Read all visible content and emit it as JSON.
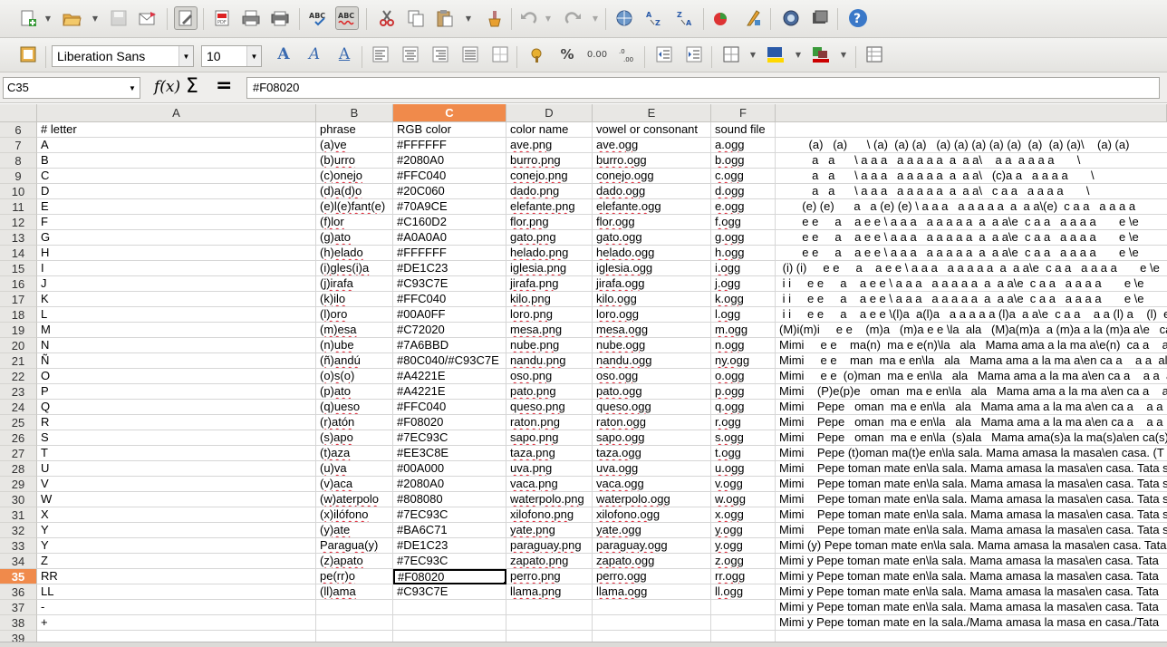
{
  "toolbar1": {
    "icons": [
      "new-icon",
      "open-icon",
      "save-icon",
      "email-icon",
      "edit-mode-icon",
      "export-pdf-icon",
      "print-icon",
      "print-preview-icon",
      "spellcheck-icon",
      "autospell-icon",
      "cut-icon",
      "copy-icon",
      "paste-icon",
      "clone-formatting-icon",
      "undo-icon",
      "redo-icon",
      "hyperlink-icon",
      "sort-ascending-icon",
      "sort-descending-icon",
      "chart-icon",
      "draw-functions-icon",
      "navigator-icon",
      "gallery-icon",
      "help-icon"
    ],
    "help_label": "?",
    "spell_label": "ABC"
  },
  "toolbar2": {
    "font_name": "Liberation Sans",
    "font_size": "10",
    "percent_label": "%",
    "decimal_label": "0.00"
  },
  "formula_bar": {
    "cell_ref": "C35",
    "fx_label": "f(x)",
    "sum_label": "Σ",
    "equal_label": "=",
    "content": "#F08020"
  },
  "columns": [
    "A",
    "B",
    "C",
    "D",
    "E",
    "F"
  ],
  "selected_column": "C",
  "selected_row": "35",
  "rows": [
    {
      "n": "6",
      "a": "# letter",
      "b": "phrase",
      "c": "RGB color",
      "d": "color name",
      "e": "vowel or consonant",
      "f": "sound file",
      "g": ""
    },
    {
      "n": "7",
      "a": "A",
      "b": "(a)ve",
      "c": "#FFFFFF",
      "d": "ave.png",
      "e": "ave.ogg",
      "f": "a.ogg",
      "g": "         (a)   (a)      \\ (a)  (a) (a)   (a) (a) (a) (a) (a)  (a)  (a) (a)\\    (a) (a)"
    },
    {
      "n": "8",
      "a": "B",
      "b": "(b)urro",
      "c": "#2080A0",
      "d": "burro.png",
      "e": "burro.ogg",
      "f": "b.ogg",
      "g": "          a   a      \\ a a a   a a a a a  a  a a\\    a a  a a a a       \\"
    },
    {
      "n": "9",
      "a": "C",
      "b": "(c)onejo",
      "c": "#FFC040",
      "d": "conejo.png",
      "e": "conejo.ogg",
      "f": "c.ogg",
      "g": "          a   a      \\ a a a   a a a a a  a  a a\\   (c)a a   a a a a       \\"
    },
    {
      "n": "10",
      "a": "D",
      "b": "(d)a(d)o",
      "c": "#20C060",
      "d": "dado.png",
      "e": "dado.ogg",
      "f": "d.ogg",
      "g": "          a   a      \\ a a a   a a a a a  a  a a\\   c a a   a a a a       \\"
    },
    {
      "n": "11",
      "a": "E",
      "b": "(e)l(e)fant(e)",
      "c": "#70A9CE",
      "d": "elefante.png",
      "e": "elefante.ogg",
      "f": "e.ogg",
      "g": "       (e) (e)      a   a (e) (e) \\ a a a   a a a a a  a  a a\\(e)  c a a   a a a a"
    },
    {
      "n": "12",
      "a": "F",
      "b": "(f)lor",
      "c": "#C160D2",
      "d": "flor.png",
      "e": "flor.ogg",
      "f": "f.ogg",
      "g": "       e e     a    a e e \\ a a a   a a a a a  a  a a\\e  c a a   a a a a       e \\e"
    },
    {
      "n": "13",
      "a": "G",
      "b": "(g)ato",
      "c": "#A0A0A0",
      "d": "gato.png",
      "e": "gato.ogg",
      "f": "g.ogg",
      "g": "       e e     a    a e e \\ a a a   a a a a a  a  a a\\e  c a a   a a a a       e \\e"
    },
    {
      "n": "14",
      "a": "H",
      "b": "(h)elado",
      "c": "#FFFFFF",
      "d": "helado.png",
      "e": "helado.ogg",
      "f": "h.ogg",
      "g": "       e e     a    a e e \\ a a a   a a a a a  a  a a\\e  c a a   a a a a       e \\e"
    },
    {
      "n": "15",
      "a": "I",
      "b": "(i)gles(i)a",
      "c": "#DE1C23",
      "d": "iglesia.png",
      "e": "iglesia.ogg",
      "f": "i.ogg",
      "g": " (i) (i)     e e     a    a e e \\ a a a   a a a a a  a  a a\\e  c a a   a a a a       e \\e"
    },
    {
      "n": "16",
      "a": "J",
      "b": "(j)irafa",
      "c": "#C93C7E",
      "d": "jirafa.png",
      "e": "jirafa.ogg",
      "f": "j.ogg",
      "g": " i i     e e     a    a e e \\ a a a   a a a a a  a  a a\\e  c a a   a a a a       e \\e"
    },
    {
      "n": "17",
      "a": "K",
      "b": "(k)ilo",
      "c": "#FFC040",
      "d": "kilo.png",
      "e": "kilo.ogg",
      "f": "k.ogg",
      "g": " i i     e e     a    a e e \\ a a a   a a a a a  a  a a\\e  c a a   a a a a       e \\e"
    },
    {
      "n": "18",
      "a": "L",
      "b": "(l)oro",
      "c": "#00A0FF",
      "d": "loro.png",
      "e": "loro.ogg",
      "f": "l.ogg",
      "g": " i i     e e     a    a e e \\(l)a  a(l)a   a a a a a (l)a  a a\\e  c a a    a a (l) a    (l)  e"
    },
    {
      "n": "19",
      "a": "M",
      "b": "(m)esa",
      "c": "#C72020",
      "d": "mesa.png",
      "e": "mesa.ogg",
      "f": "m.ogg",
      "g": "(M)i(m)i     e e    (m)a   (m)a e e \\la  ala   (M)a(m)a  a (m)a a la (m)a a\\e   ca a"
    },
    {
      "n": "20",
      "a": "N",
      "b": "(n)ube",
      "c": "#7A6BBD",
      "d": "nube.png",
      "e": "nube.ogg",
      "f": "n.ogg",
      "g": "Mimi     e e    ma(n)  ma e e(n)\\la   ala   Mama ama a la ma a\\e(n)  ca a    a a"
    },
    {
      "n": "21",
      "a": "Ñ",
      "b": "(ñ)andú",
      "c": "#80C040/#C93C7E",
      "d": "nandu.png",
      "e": "nandu.ogg",
      "f": "ny.ogg",
      "g": "Mimi     e e    man  ma e en\\la   ala   Mama ama a la ma a\\en ca a    a a  al a"
    },
    {
      "n": "22",
      "a": "O",
      "b": "(o)s(o)",
      "c": "#A4221E",
      "d": "oso.png",
      "e": "oso.ogg",
      "f": "o.ogg",
      "g": "Mimi     e e  (o)man  ma e en\\la   ala   Mama ama a la ma a\\en ca a    a a  al"
    },
    {
      "n": "23",
      "a": "P",
      "b": "(p)ato",
      "c": "#A4221E",
      "d": "pato.png",
      "e": "pato.ogg",
      "f": "p.ogg",
      "g": "Mimi    (P)e(p)e   oman  ma e en\\la   ala   Mama ama a la ma a\\en ca a    a a"
    },
    {
      "n": "24",
      "a": "Q",
      "b": "(q)ueso",
      "c": "#FFC040",
      "d": "queso.png",
      "e": "queso.ogg",
      "f": "q.ogg",
      "g": "Mimi    Pepe   oman  ma e en\\la   ala   Mama ama a la ma a\\en ca a    a a  al"
    },
    {
      "n": "25",
      "a": "R",
      "b": "(r)atón",
      "c": "#F08020",
      "d": "raton.png",
      "e": "raton.ogg",
      "f": "r.ogg",
      "g": "Mimi    Pepe   oman  ma e en\\la   ala   Mama ama a la ma a\\en ca a    a a  al"
    },
    {
      "n": "26",
      "a": "S",
      "b": "(s)apo",
      "c": "#7EC93C",
      "d": "sapo.png",
      "e": "sapo.ogg",
      "f": "s.ogg",
      "g": "Mimi    Pepe   oman  ma e en\\la  (s)ala   Mama ama(s)a la ma(s)a\\en ca(s)a."
    },
    {
      "n": "27",
      "a": "T",
      "b": "(t)aza",
      "c": "#EE3C8E",
      "d": "taza.png",
      "e": "taza.ogg",
      "f": "t.ogg",
      "g": "Mimi    Pepe (t)oman ma(t)e en\\la sala. Mama amasa la masa\\en casa. (T"
    },
    {
      "n": "28",
      "a": "U",
      "b": "(u)va",
      "c": "#00A000",
      "d": "uva.png",
      "e": "uva.ogg",
      "f": "u.ogg",
      "g": "Mimi    Pepe toman mate en\\la sala. Mama amasa la masa\\en casa. Tata s"
    },
    {
      "n": "29",
      "a": "V",
      "b": "(v)aca",
      "c": "#2080A0",
      "d": "vaca.png",
      "e": "vaca.ogg",
      "f": "v.ogg",
      "g": "Mimi    Pepe toman mate en\\la sala. Mama amasa la masa\\en casa. Tata s"
    },
    {
      "n": "30",
      "a": "W",
      "b": "(w)aterpolo",
      "c": "#808080",
      "d": "waterpolo.png",
      "e": "waterpolo.ogg",
      "f": "w.ogg",
      "g": "Mimi    Pepe toman mate en\\la sala. Mama amasa la masa\\en casa. Tata s"
    },
    {
      "n": "31",
      "a": "X",
      "b": "(x)ilófono",
      "c": "#7EC93C",
      "d": "xilofono.png",
      "e": "xilofono.ogg",
      "f": "x.ogg",
      "g": "Mimi    Pepe toman mate en\\la sala. Mama amasa la masa\\en casa. Tata s"
    },
    {
      "n": "32",
      "a": "Y",
      "b": "(y)ate",
      "c": "#BA6C71",
      "d": "yate.png",
      "e": "yate.ogg",
      "f": "y.ogg",
      "g": "Mimi    Pepe toman mate en\\la sala. Mama amasa la masa\\en casa. Tata s"
    },
    {
      "n": "33",
      "a": "Y",
      "b": "Paragua(y)",
      "c": "#DE1C23",
      "d": "paraguay.png",
      "e": "paraguay.ogg",
      "f": "y.ogg",
      "g": "Mimi (y) Pepe toman mate en\\la sala. Mama amasa la masa\\en casa. Tata"
    },
    {
      "n": "34",
      "a": "Z",
      "b": "(z)apato",
      "c": "#7EC93C",
      "d": "zapato.png",
      "e": "zapato.ogg",
      "f": "z.ogg",
      "g": "Mimi y Pepe toman mate en\\la sala. Mama amasa la masa\\en casa. Tata"
    },
    {
      "n": "35",
      "a": "RR",
      "b": "pe(rr)o",
      "c": "#F08020",
      "d": "perro.png",
      "e": "perro.ogg",
      "f": "rr.ogg",
      "g": "Mimi y Pepe toman mate en\\la sala. Mama amasa la masa\\en casa. Tata"
    },
    {
      "n": "36",
      "a": "LL",
      "b": "(ll)ama",
      "c": "#C93C7E",
      "d": "llama.png",
      "e": "llama.ogg",
      "f": "ll.ogg",
      "g": "Mimi y Pepe toman mate en\\la sala. Mama amasa la masa\\en casa. Tata"
    },
    {
      "n": "37",
      "a": "-",
      "b": "",
      "c": "",
      "d": "",
      "e": "",
      "f": "",
      "g": "Mimi y Pepe toman mate en\\la sala. Mama amasa la masa\\en casa. Tata"
    },
    {
      "n": "38",
      "a": "+",
      "b": "",
      "c": "",
      "d": "",
      "e": "",
      "f": "",
      "g": "Mimi y Pepe toman mate en la sala./Mama amasa la masa en casa./Tata"
    },
    {
      "n": "39",
      "a": "",
      "b": "",
      "c": "",
      "d": "",
      "e": "",
      "f": "",
      "g": ""
    }
  ]
}
